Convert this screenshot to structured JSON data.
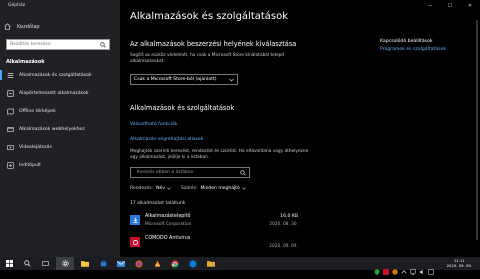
{
  "window": {
    "title": "Gépház",
    "controls": {
      "minimize": "—",
      "maximize": "☐",
      "close": "✕"
    }
  },
  "sidebar": {
    "home_label": "Kezdőlap",
    "search_placeholder": "Beállítás keresése",
    "section_title": "Alkalmazások",
    "items": [
      {
        "label": "Alkalmazások és szolgáltatások",
        "icon": "list-icon"
      },
      {
        "label": "Alapértelmezett alkalmazások",
        "icon": "default-apps-icon"
      },
      {
        "label": "Offline térképek",
        "icon": "map-icon"
      },
      {
        "label": "Alkalmazások webhelyekhez",
        "icon": "web-icon"
      },
      {
        "label": "Videolejátszás",
        "icon": "video-icon"
      },
      {
        "label": "Indítópult",
        "icon": "startup-icon"
      }
    ]
  },
  "main": {
    "title": "Alkalmazások és szolgáltatások",
    "install_section": {
      "heading": "Az alkalmazások beszerzési helyének kiválasztása",
      "description": "Segítő az eszköz védelmét, ha csak a Microsoft Store kínálatából telepít alkalmazásokat.",
      "dropdown_value": "Csak a Microsoft Store-ból (ajánlott)"
    },
    "apps_section": {
      "heading": "Alkalmazások és szolgáltatások",
      "link_optional": "Választható funkciók",
      "link_aliases": "Alkalmazás-végrehajtási aliasok",
      "description": "Meghajtók szerinti keresést, rendezést és szűrést. Ha eltávolítana vagy áthelyezne egy alkalmazást, jelölje ki a listában.",
      "search_placeholder": "Keresés ebben a listában",
      "sort_label": "Rendezés:",
      "sort_value": "Név",
      "filter_label": "Szűrés:",
      "filter_value": "Minden meghajtó",
      "count_text": "17 alkalmazást találtunk",
      "apps": [
        {
          "name": "Alkalmazástelepítő",
          "publisher": "Microsoft Corporation",
          "size": "16,0 KB",
          "date": "2020. 08. 30.",
          "icon": "app-installer-icon",
          "icon_color": "#2b78d6"
        },
        {
          "name": "COMODO Antivirus",
          "publisher": "",
          "size": "",
          "date": "2020. 09. 04.",
          "icon": "comodo-icon",
          "icon_color": "#c8102e"
        }
      ]
    },
    "related": {
      "title": "Kapcsolódó beállítások",
      "link": "Programok és szolgáltatások"
    }
  },
  "taskbar": {
    "time": "11:11",
    "date": "2020. 09. 09.",
    "items": [
      {
        "icon": "windows-start-icon"
      },
      {
        "icon": "search-icon"
      },
      {
        "icon": "task-view-icon"
      },
      {
        "icon": "file-explorer-icon"
      },
      {
        "icon": "settings-icon"
      },
      {
        "icon": "store-icon"
      },
      {
        "icon": "mail-icon"
      },
      {
        "icon": "photos-icon"
      },
      {
        "icon": "firefox-icon"
      },
      {
        "icon": "vlc-icon"
      },
      {
        "icon": "chrome-icon"
      },
      {
        "icon": "edge-icon"
      },
      {
        "icon": "folder-icon"
      }
    ]
  },
  "colors": {
    "accent": "#4aa3ff",
    "link": "#6ab2ff",
    "sidebar_bg": "#1f2125"
  }
}
